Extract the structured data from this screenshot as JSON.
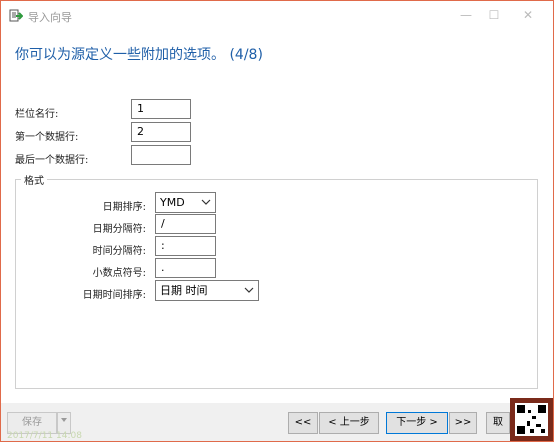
{
  "window": {
    "title": "导入向导",
    "icon": "import-wizard-icon",
    "controls": {
      "minimize": "—",
      "maximize": "☐",
      "close": "✕"
    }
  },
  "heading": "你可以为源定义一些附加的选项。 (4/8)",
  "rows": {
    "field_name_row_label": "栏位名行:",
    "field_name_row_value": "1",
    "first_data_row_label": "第一个数据行:",
    "first_data_row_value": "2",
    "last_data_row_label": "最后一个数据行:",
    "last_data_row_value": ""
  },
  "format": {
    "legend": "格式",
    "date_order_label": "日期排序:",
    "date_order_value": "YMD",
    "date_separator_label": "日期分隔符:",
    "date_separator_value": "/",
    "time_separator_label": "时间分隔符:",
    "time_separator_value": ":",
    "decimal_symbol_label": "小数点符号:",
    "decimal_symbol_value": ".",
    "datetime_order_label": "日期时间排序:",
    "datetime_order_value": "日期 时间"
  },
  "footer": {
    "save_label": "保存",
    "first_label": "<<",
    "prev_label": "< 上一步",
    "next_label": "下一步 >",
    "last_label": ">>",
    "cancel_label": "取",
    "timestamp": "2017/7/11 14:08"
  },
  "colors": {
    "heading": "#1f5fa8",
    "accent": "#0078d7",
    "window_border": "#e06a4a"
  }
}
